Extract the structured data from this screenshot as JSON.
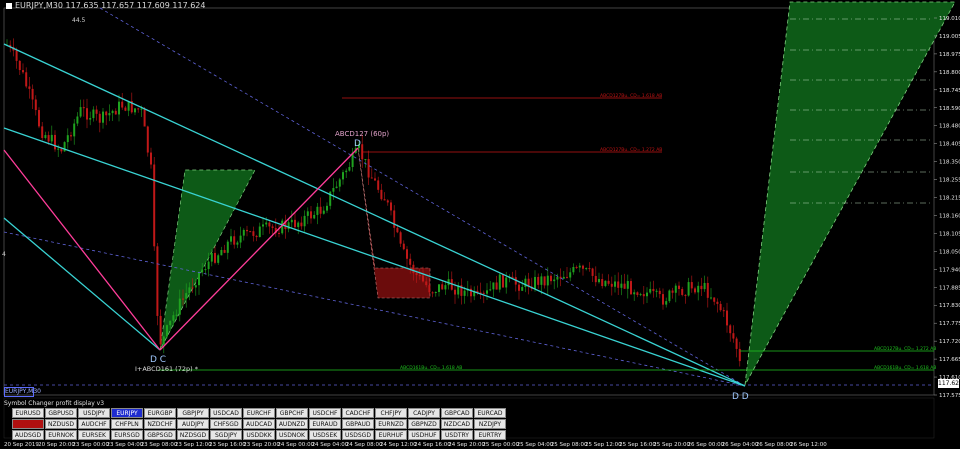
{
  "window": {
    "title": "EURJPY,M30  117.635 117.657 117.609 117.624"
  },
  "axis": {
    "price_labels": [
      "119.010",
      "119.005",
      "118.975",
      "118.800",
      "118.745",
      "118.590",
      "118.480",
      "118.405",
      "118.350",
      "118.255",
      "118.215",
      "118.160",
      "118.105",
      "118.050",
      "117.940",
      "117.885",
      "117.830",
      "117.775",
      "117.720",
      "117.665",
      "117.610",
      "117.575"
    ],
    "current_price": "117.624",
    "time_labels": [
      "20 Sep 2019",
      "20 Sep 20:00",
      "23 Sep 00:00",
      "23 Sep 04:00",
      "23 Sep 08:00",
      "23 Sep 12:00",
      "23 Sep 16:00",
      "23 Sep 20:00",
      "24 Sep 00:00",
      "24 Sep 04:00",
      "24 Sep 08:00",
      "24 Sep 12:00",
      "24 Sep 16:00",
      "24 Sep 20:00",
      "25 Sep 00:00",
      "25 Sep 04:00",
      "25 Sep 08:00",
      "25 Sep 12:00",
      "25 Sep 16:00",
      "25 Sep 20:00",
      "26 Sep 00:00",
      "26 Sep 04:00",
      "26 Sep 08:00",
      "26 Sep 12:00"
    ]
  },
  "annotations": {
    "top_left_number": "44.5",
    "left_marker": "4",
    "abcd_top": "ABCD127 (60p)",
    "point_d_top": "D",
    "point_dc": "D C",
    "abcd_bottom": "I+ABCD161 (72p) *",
    "point_dd": "D D",
    "level_1": "ABCD127Bu. CD= 1.618 AB",
    "level_2": "ABCD127Bu. CD= 1.272 AB",
    "level_3": "ABCD161Bu. CD= 1.618 AB",
    "level_4": "ABCD127Bu. CD= 1.272 AB",
    "level_5": "ABCD161Bu. CD= 1.618 AB"
  },
  "chip": {
    "label": "EURJPY,M30"
  },
  "symbol_panel": {
    "title": "Symbol Changer profit display v3",
    "rows": [
      [
        "EURUSD",
        "GBPUSD",
        "USDJPY",
        "EURJPY",
        "EURGBP",
        "GBPJPY",
        "USDCAD",
        "EURCHF",
        "GBPCHF",
        "USDCHF",
        "CADCHF",
        "CHFJPY",
        "CADJPY",
        "GBPCAD",
        "EURCAD"
      ],
      [
        "AUDUSD",
        "NZDUSD",
        "AUDCHF",
        "CHFPLN",
        "NZDCHF",
        "AUDJPY",
        "CHFSGD",
        "AUDCAD",
        "AUDNZD",
        "EURAUD",
        "GBPAUD",
        "EURNZD",
        "GBPNZD",
        "NZDCAD",
        "NZDJPY"
      ],
      [
        "AUDSGD",
        "EURNOK",
        "EURSEK",
        "EURSGD",
        "GBPSGD",
        "NZDSGD",
        "SGDJPY",
        "USDDKK",
        "USDNOK",
        "USDSEK",
        "USDSGD",
        "EURHUF",
        "USDHUF",
        "USDTRY",
        "EURTRY"
      ]
    ],
    "selected": "EURJPY",
    "highlighted_red": "AUDUSD"
  },
  "colors": {
    "bull": "#1fa21f",
    "bear": "#c01818",
    "trend": "#39d3d3",
    "pattern_pink": "#ff3d9a",
    "green_fill": "#0d5a17",
    "red_fill": "#6b0c0c",
    "level_red": "#c41414",
    "level_green": "#1fc41f"
  },
  "chart_data": {
    "type": "candlestick",
    "symbol": "EURJPY",
    "timeframe": "M30",
    "ohlc_header": {
      "open": 117.635,
      "high": 117.657,
      "low": 117.609,
      "close": 117.624
    }
  }
}
